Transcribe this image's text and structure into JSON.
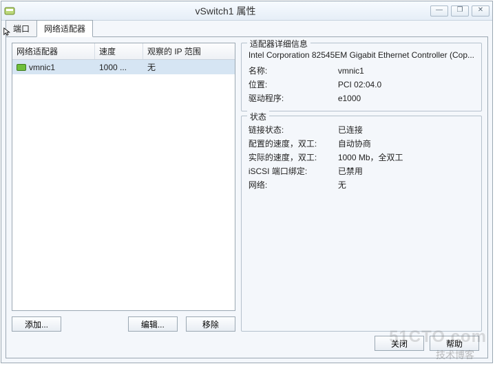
{
  "window": {
    "title": "vSwitch1 属性",
    "min": "—",
    "restore": "❐",
    "close": "✕"
  },
  "tabs": {
    "ports": "端口",
    "adapters": "网络适配器"
  },
  "list": {
    "headers": {
      "name": "网络适配器",
      "speed": "速度",
      "range": "观察的 IP 范围"
    },
    "rows": [
      {
        "name": "vmnic1",
        "speed": "1000 ...",
        "range": "无"
      }
    ]
  },
  "details": {
    "group_title": "适配器详细信息",
    "controller": "Intel Corporation 82545EM Gigabit Ethernet Controller (Cop...",
    "name_label": "名称:",
    "name_value": "vmnic1",
    "location_label": "位置:",
    "location_value": "PCI 02:04.0",
    "driver_label": "驱动程序:",
    "driver_value": "e1000"
  },
  "status": {
    "group_title": "状态",
    "link_label": "链接状态:",
    "link_value": "已连接",
    "cfg_label": "配置的速度，双工:",
    "cfg_value": "自动协商",
    "act_label": "实际的速度，双工:",
    "act_value": "1000 Mb，全双工",
    "iscsi_label": "iSCSI 端口绑定:",
    "iscsi_value": "已禁用",
    "net_label": "网络:",
    "net_value": "无"
  },
  "buttons": {
    "add": "添加...",
    "edit": "编辑...",
    "remove": "移除",
    "close": "关闭",
    "help": "帮助"
  },
  "watermark": "51CTO.com",
  "watermark2": "技术博客"
}
